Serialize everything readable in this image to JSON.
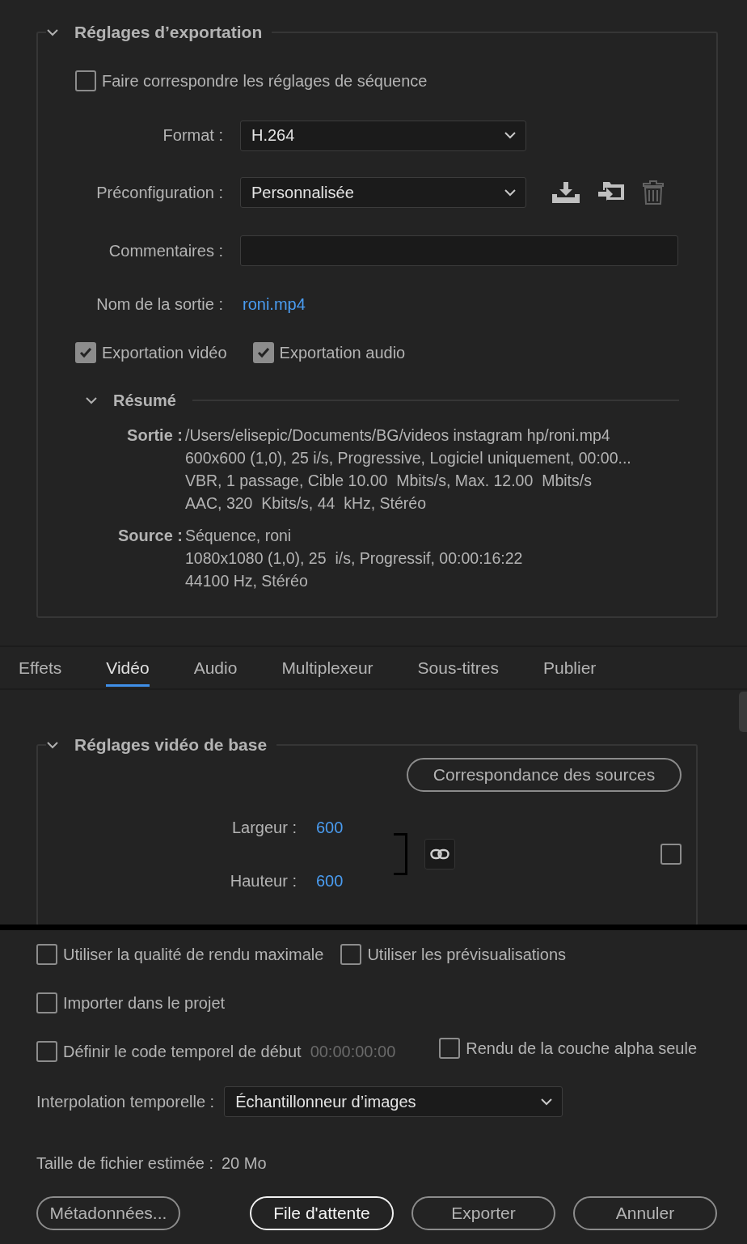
{
  "export_settings": {
    "title": "Réglages d’exportation",
    "expanded": true,
    "match_sequence": {
      "label": "Faire correspondre les réglages de séquence",
      "checked": false
    },
    "format": {
      "label": "Format :",
      "value": "H.264"
    },
    "preset": {
      "label": "Préconfiguration :",
      "value": "Personnalisée",
      "delete_disabled": true
    },
    "comments": {
      "label": "Commentaires :"
    },
    "output_name": {
      "label": "Nom de la sortie :",
      "value": "roni.mp4"
    },
    "export_toggles": [
      {
        "label": "Exportation vidéo",
        "checked": true
      },
      {
        "label": "Exportation audio",
        "checked": true
      }
    ],
    "summary": {
      "title": "Résumé",
      "expanded": true,
      "groups": [
        {
          "label": "Sortie :",
          "lines": [
            "/Users/elisepic/Documents/BG/videos instagram hp/roni.mp4",
            "600x600 (1,0), 25 i/s, Progressive, Logiciel uniquement, 00:00...",
            "VBR, 1 passage, Cible 10.00  Mbits/s, Max. 12.00  Mbits/s",
            "AAC, 320  Kbits/s, 44  kHz, Stéréo"
          ]
        },
        {
          "label": "Source :",
          "lines": [
            "Séquence, roni",
            "1080x1080 (1,0), 25  i/s, Progressif, 00:00:16:22",
            "44100 Hz, Stéréo"
          ]
        }
      ]
    }
  },
  "tabs": [
    {
      "label": "Effets",
      "selected": false
    },
    {
      "label": "Vidéo",
      "selected": true
    },
    {
      "label": "Audio",
      "selected": false
    },
    {
      "label": "Multiplexeur",
      "selected": false
    },
    {
      "label": "Sous-titres",
      "selected": false
    },
    {
      "label": "Publier",
      "selected": false
    }
  ],
  "basic_video": {
    "title": "Réglages vidéo de base",
    "expanded": true,
    "match_source_button": "Correspondance des sources",
    "width": {
      "label": "Largeur :",
      "value": "600"
    },
    "height": {
      "label": "Hauteur :",
      "value": "600"
    },
    "side_checkbox": {
      "checked": false
    }
  },
  "options": [
    [
      {
        "label": "Utiliser la qualité de rendu maximale",
        "checked": false
      },
      {
        "label": "Utiliser les prévisualisations",
        "checked": false
      }
    ],
    [
      {
        "label": "Importer dans le projet",
        "checked": false
      }
    ],
    [
      {
        "label": "Définir le code temporel de début",
        "checked": false,
        "timecode": "00:00:00:00"
      },
      {
        "label": "Rendu de la couche alpha seule",
        "checked": false
      }
    ]
  ],
  "time_interpolation": {
    "label": "Interpolation temporelle :",
    "value": "Échantillonneur d’images"
  },
  "estimated_size": {
    "label": "Taille de fichier estimée :",
    "value": "20 Mo"
  },
  "buttons": [
    {
      "label": "Métadonnées...",
      "kind": "normal"
    },
    {
      "label": "File d'attente",
      "kind": "default"
    },
    {
      "label": "Exporter",
      "kind": "normal"
    },
    {
      "label": "Annuler",
      "kind": "normal"
    }
  ]
}
